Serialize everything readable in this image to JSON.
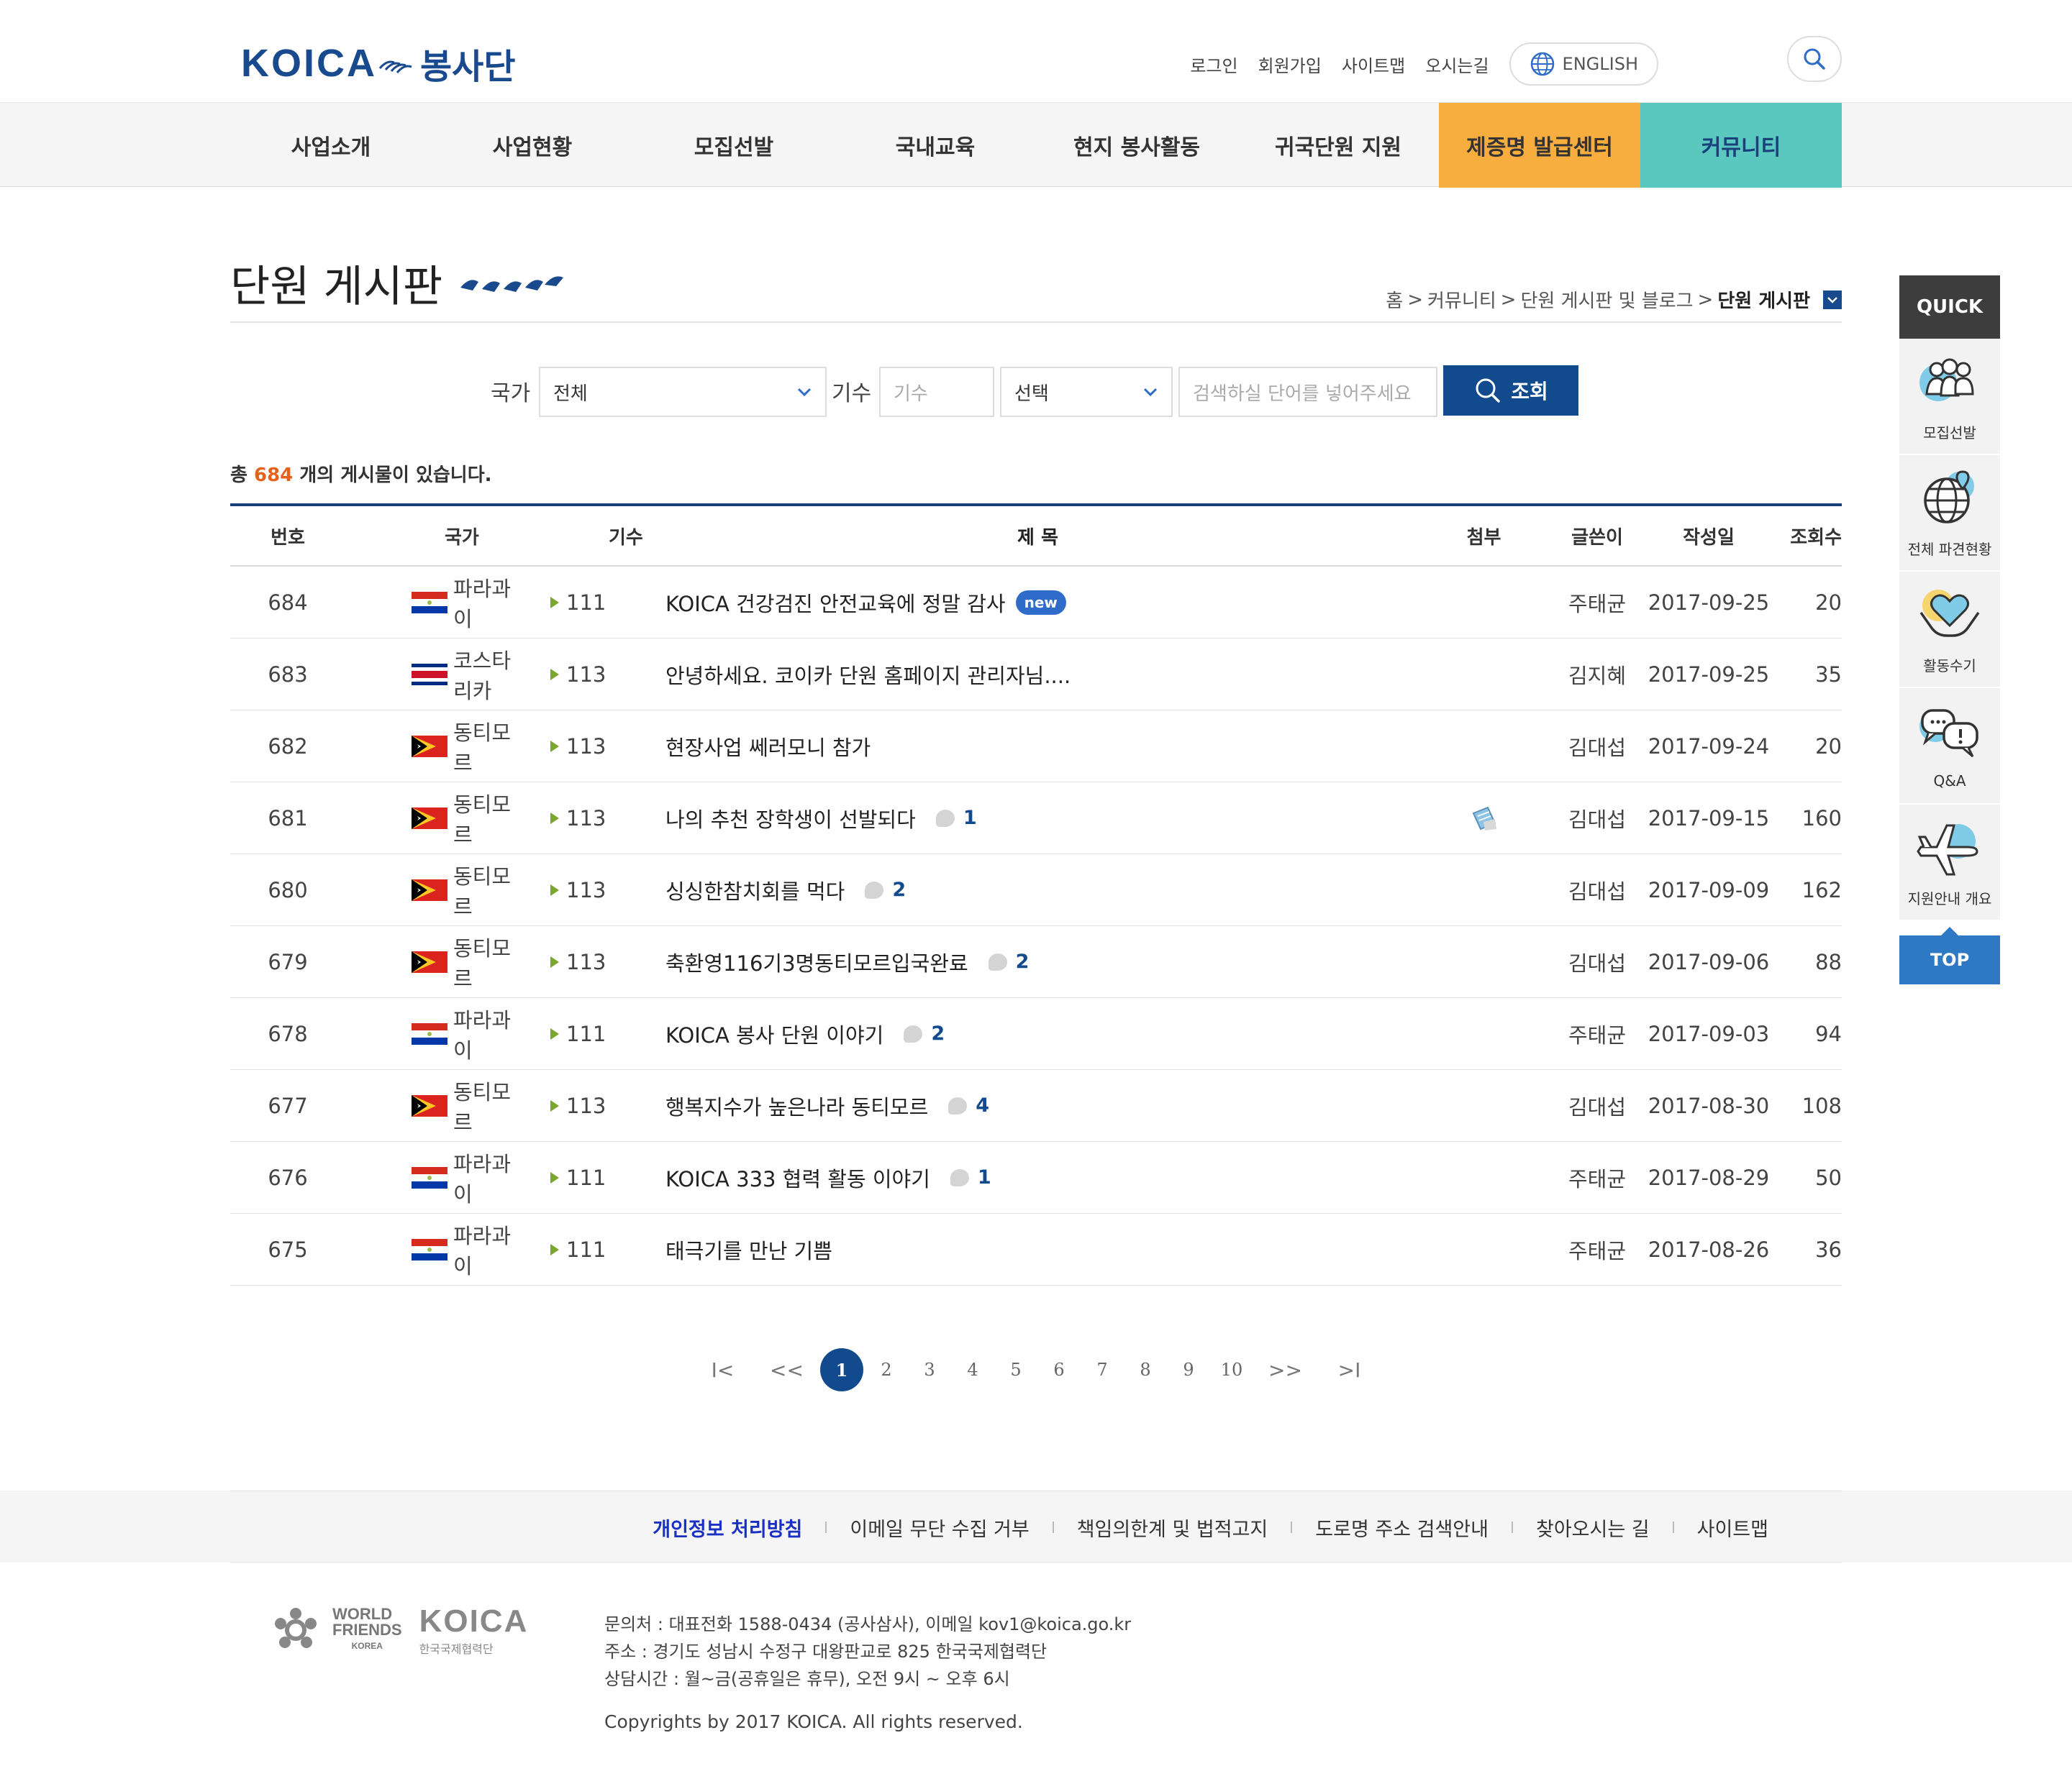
{
  "header": {
    "logo_text": "KOICA",
    "logo_sub": "봉사단",
    "util_links": [
      "로그인",
      "회원가입",
      "사이트맵",
      "오시는길"
    ],
    "english_label": "ENGLISH",
    "search_icon": "search-icon"
  },
  "gnb": {
    "items": [
      "사업소개",
      "사업현황",
      "모집선발",
      "국내교육",
      "현지 봉사활동",
      "귀국단원 지원",
      "제증명 발급센터",
      "커뮤니티"
    ],
    "highlight_colors": {
      "orange": "#f8ad3f",
      "teal": "#5bc8c0"
    }
  },
  "page": {
    "title": "단원 게시판",
    "breadcrumb": [
      "홈",
      "커뮤니티",
      "단원 게시판 및 블로그",
      "단원 게시판"
    ]
  },
  "search": {
    "country_label": "국가",
    "country_value": "전체",
    "term_label": "기수",
    "term_placeholder": "기수",
    "select_value": "선택",
    "keyword_placeholder": "검색하실 단어를 넣어주세요",
    "submit_label": "조회"
  },
  "count": {
    "prefix": "총",
    "number": "684",
    "suffix": "개의 게시물이 있습니다."
  },
  "table": {
    "headers": {
      "no": "번호",
      "country": "국가",
      "term": "기수",
      "title": "제 목",
      "attach": "첨부",
      "writer": "글쓴이",
      "date": "작성일",
      "views": "조회수"
    },
    "rows": [
      {
        "no": "684",
        "country": "파라과이",
        "flag": "paraguay",
        "term": "111",
        "title": "KOICA 건강검진 안전교육에 정말 감사",
        "badge": "new",
        "comments": "",
        "attach": false,
        "writer": "주태균",
        "date": "2017-09-25",
        "views": "20"
      },
      {
        "no": "683",
        "country": "코스타리카",
        "flag": "costarica",
        "term": "113",
        "title": "안녕하세요. 코이카 단원 홈페이지 관리자님....",
        "badge": "",
        "comments": "",
        "attach": false,
        "writer": "김지혜",
        "date": "2017-09-25",
        "views": "35"
      },
      {
        "no": "682",
        "country": "동티모르",
        "flag": "timor",
        "term": "113",
        "title": "현장사업 쎄러모니 참가",
        "badge": "",
        "comments": "",
        "attach": false,
        "writer": "김대섭",
        "date": "2017-09-24",
        "views": "20"
      },
      {
        "no": "681",
        "country": "동티모르",
        "flag": "timor",
        "term": "113",
        "title": "나의 추천 장학생이 선발되다",
        "badge": "",
        "comments": "1",
        "attach": true,
        "writer": "김대섭",
        "date": "2017-09-15",
        "views": "160"
      },
      {
        "no": "680",
        "country": "동티모르",
        "flag": "timor",
        "term": "113",
        "title": "싱싱한참치회를 먹다",
        "badge": "",
        "comments": "2",
        "attach": false,
        "writer": "김대섭",
        "date": "2017-09-09",
        "views": "162"
      },
      {
        "no": "679",
        "country": "동티모르",
        "flag": "timor",
        "term": "113",
        "title": "축환영116기3명동티모르입국완료",
        "badge": "",
        "comments": "2",
        "attach": false,
        "writer": "김대섭",
        "date": "2017-09-06",
        "views": "88"
      },
      {
        "no": "678",
        "country": "파라과이",
        "flag": "paraguay",
        "term": "111",
        "title": "KOICA 봉사 단원 이야기",
        "badge": "",
        "comments": "2",
        "attach": false,
        "writer": "주태균",
        "date": "2017-09-03",
        "views": "94"
      },
      {
        "no": "677",
        "country": "동티모르",
        "flag": "timor",
        "term": "113",
        "title": "행복지수가 높은나라 동티모르",
        "badge": "",
        "comments": "4",
        "attach": false,
        "writer": "김대섭",
        "date": "2017-08-30",
        "views": "108"
      },
      {
        "no": "676",
        "country": "파라과이",
        "flag": "paraguay",
        "term": "111",
        "title": "KOICA 333 협력 활동 이야기",
        "badge": "",
        "comments": "1",
        "attach": false,
        "writer": "주태균",
        "date": "2017-08-29",
        "views": "50"
      },
      {
        "no": "675",
        "country": "파라과이",
        "flag": "paraguay",
        "term": "111",
        "title": "태극기를 만난 기쁨",
        "badge": "",
        "comments": "",
        "attach": false,
        "writer": "주태균",
        "date": "2017-08-26",
        "views": "36"
      }
    ]
  },
  "pager": {
    "first": "I<",
    "prev": "<<",
    "pages": [
      "1",
      "2",
      "3",
      "4",
      "5",
      "6",
      "7",
      "8",
      "9",
      "10"
    ],
    "current": "1",
    "next": ">>",
    "last": ">I"
  },
  "footer": {
    "links": [
      "개인정보 처리방침",
      "이메일 무단 수집 거부",
      "책임의한계 및 법적고지",
      "도로명 주소 검색안내",
      "찾아오시는 길",
      "사이트맵"
    ],
    "wf_lines": [
      "WORLD",
      "FRIENDS",
      "KOREA"
    ],
    "koica_logo": "KOICA",
    "koica_sub": "한국국제협력단",
    "info": [
      "문의처 : 대표전화 1588-0434 (공사삼사), 이메일 kov1@koica.go.kr",
      "주소 : 경기도 성남시 수정구 대왕판교로 825 한국국제협력단",
      "상담시간 : 월~금(공휴일은 휴무), 오전 9시 ~ 오후 6시"
    ],
    "copyright": "Copyrights by 2017 KOICA. All rights reserved."
  },
  "quick": {
    "title": "QUICK",
    "items": [
      {
        "label": "모집선발",
        "icon": "people-icon"
      },
      {
        "label": "전체 파견현황",
        "icon": "globe-icon"
      },
      {
        "label": "활동수기",
        "icon": "heart-hands-icon"
      },
      {
        "label": "Q&A",
        "icon": "chat-icon"
      },
      {
        "label": "지원안내 개요",
        "icon": "airplane-icon"
      }
    ],
    "top_label": "TOP"
  }
}
